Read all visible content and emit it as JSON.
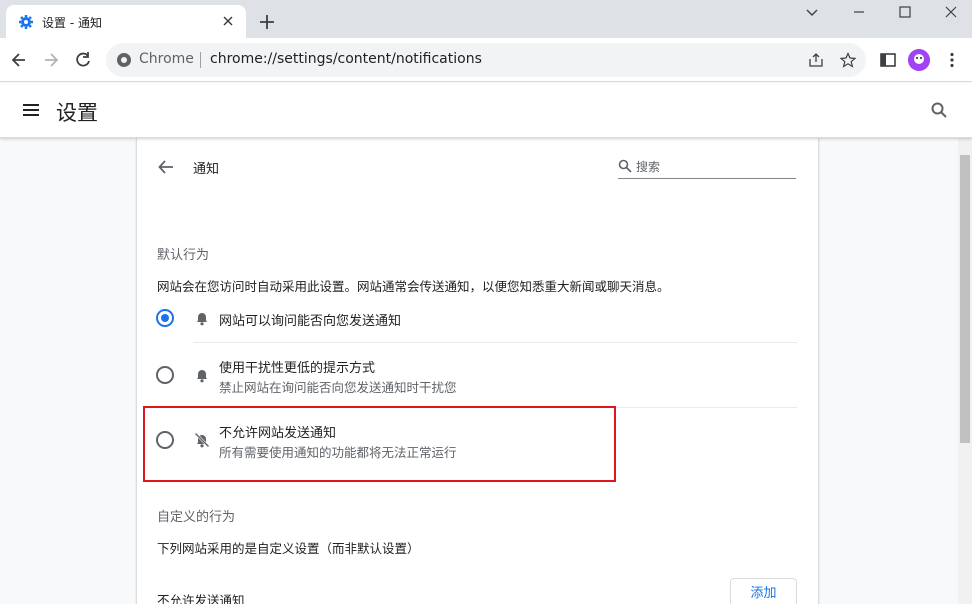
{
  "browser": {
    "tab_title": "设置 - 通知",
    "omnibox_origin": "Chrome",
    "omnibox_url": "chrome://settings/content/notifications"
  },
  "settings": {
    "title": "设置"
  },
  "subpage": {
    "title": "通知",
    "search_placeholder": "搜索"
  },
  "default_behavior": {
    "section_title": "默认行为",
    "description": "网站会在您访问时自动采用此设置。网站通常会传送通知，以便您知悉重大新闻或聊天消息。",
    "options": [
      {
        "label": "网站可以询问能否向您发送通知",
        "sublabel": "",
        "selected": true,
        "icon": "bell-icon"
      },
      {
        "label": "使用干扰性更低的提示方式",
        "sublabel": "禁止网站在询问能否向您发送通知时干扰您",
        "selected": false,
        "icon": "bell-icon"
      },
      {
        "label": "不允许网站发送通知",
        "sublabel": "所有需要使用通知的功能都将无法正常运行",
        "selected": false,
        "icon": "bell-off-icon"
      }
    ]
  },
  "custom_behavior": {
    "section_title": "自定义的行为",
    "description": "下列网站采用的是自定义设置（而非默认设置）",
    "blocked_title": "不允许发送通知",
    "add_label": "添加"
  },
  "colors": {
    "accent": "#1a73e8",
    "highlight": "#e0151e"
  }
}
